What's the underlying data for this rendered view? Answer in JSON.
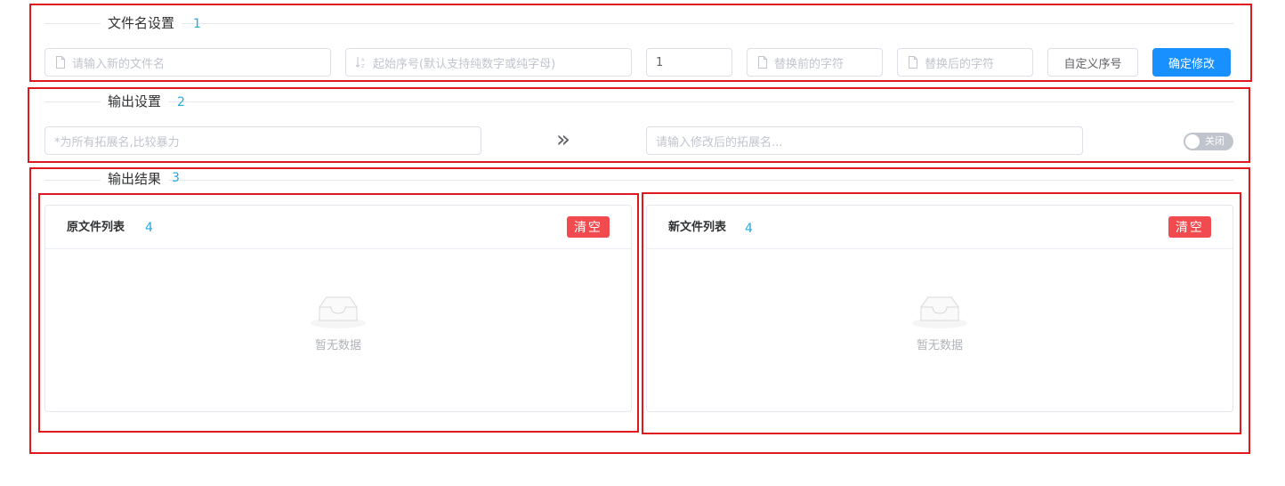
{
  "sections": {
    "filename": {
      "title": "文件名设置",
      "anno": "1"
    },
    "output": {
      "title": "输出设置",
      "anno": "2"
    },
    "result": {
      "title": "输出结果",
      "anno": "3"
    }
  },
  "filename_settings": {
    "new_name_placeholder": "请输入新的文件名",
    "start_index_placeholder": "起始序号(默认支持纯数字或纯字母)",
    "step_value": "1",
    "replace_before_placeholder": "替换前的字符",
    "replace_after_placeholder": "替换后的字符",
    "custom_index_label": "自定义序号",
    "confirm_label": "确定修改"
  },
  "output_settings": {
    "ext_placeholder": "*为所有拓展名,比较暴力",
    "arrow": "»",
    "new_ext_placeholder": "请输入修改后的拓展名...",
    "switch_label": "关闭",
    "switch_on": false
  },
  "panels": {
    "original": {
      "title": "原文件列表",
      "anno": "4",
      "clear_label": "清空",
      "empty_text": "暂无数据"
    },
    "new": {
      "title": "新文件列表",
      "anno": "4",
      "clear_label": "清空",
      "empty_text": "暂无数据"
    }
  },
  "colors": {
    "annotation_box": "#e0191e",
    "primary": "#1890ff",
    "danger": "#f24b4f",
    "annotation_number": "#2aa9e0"
  },
  "icons": {
    "file": "file-icon",
    "sort": "sort-icon",
    "empty": "inbox-icon"
  }
}
